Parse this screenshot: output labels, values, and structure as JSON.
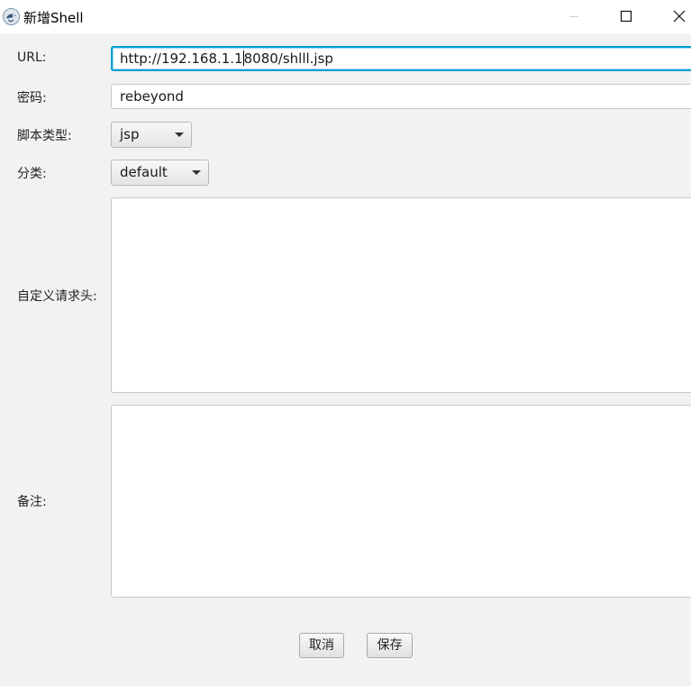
{
  "window": {
    "title": "新增Shell",
    "icons": {
      "app": "ghost-scorpion-app-icon",
      "minimize": "minimize-icon",
      "maximize": "maximize-icon",
      "close": "close-icon"
    }
  },
  "form": {
    "url": {
      "label": "URL:",
      "value_before_caret": "http://192.168.1.1",
      "value_after_caret": "8080/shlll.jsp"
    },
    "password": {
      "label": "密码:",
      "value": "rebeyond"
    },
    "script_type": {
      "label": "脚本类型:",
      "selected": "jsp"
    },
    "category": {
      "label": "分类:",
      "selected": "default"
    },
    "custom_headers": {
      "label": "自定义请求头:",
      "value": ""
    },
    "remark": {
      "label": "备注:",
      "value": ""
    }
  },
  "buttons": {
    "cancel": "取消",
    "save": "保存"
  },
  "colors": {
    "focus_border": "#039ed3",
    "background": "#f2f2f2"
  }
}
